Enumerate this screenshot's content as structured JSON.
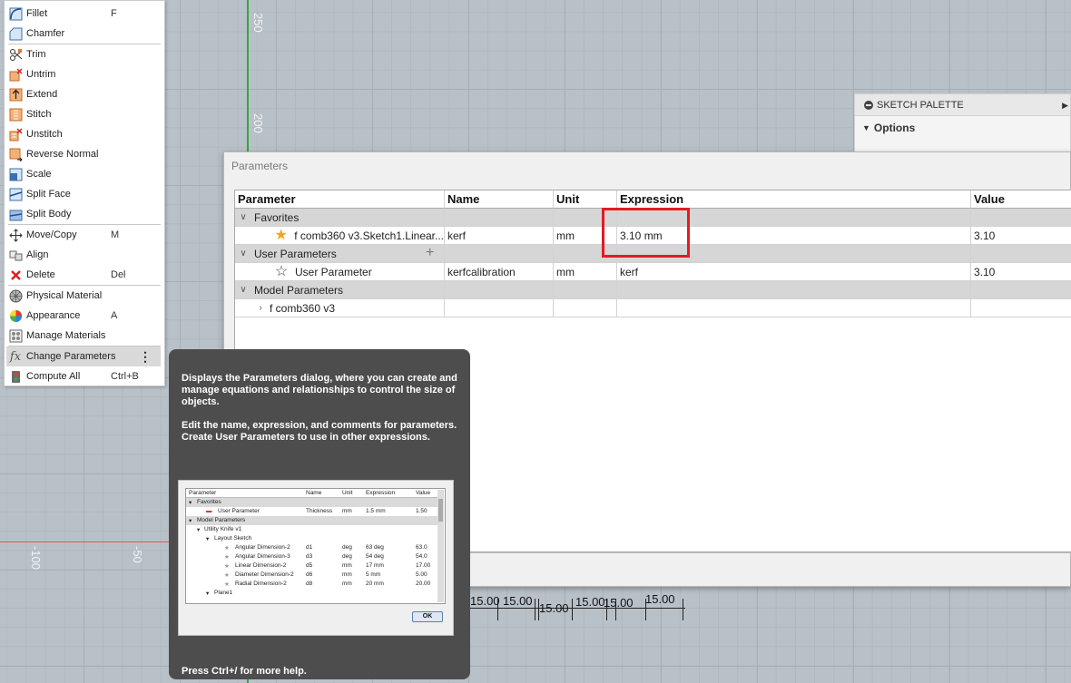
{
  "canvas": {
    "ruler_labels": [
      "250",
      "200",
      "-100",
      "-50"
    ],
    "dimensions": [
      "15.00",
      "15.00",
      "15.00",
      "15.00",
      "15.00",
      "15.00"
    ]
  },
  "menu": {
    "items": [
      {
        "label": "Fillet",
        "shortcut": "F",
        "icon": "fillet-icon"
      },
      {
        "label": "Chamfer",
        "shortcut": "",
        "icon": "chamfer-icon"
      },
      {
        "label": "Trim",
        "shortcut": "",
        "icon": "trim-icon"
      },
      {
        "label": "Untrim",
        "shortcut": "",
        "icon": "untrim-icon"
      },
      {
        "label": "Extend",
        "shortcut": "",
        "icon": "extend-icon"
      },
      {
        "label": "Stitch",
        "shortcut": "",
        "icon": "stitch-icon"
      },
      {
        "label": "Unstitch",
        "shortcut": "",
        "icon": "unstitch-icon"
      },
      {
        "label": "Reverse Normal",
        "shortcut": "",
        "icon": "reverse-normal-icon"
      },
      {
        "label": "Scale",
        "shortcut": "",
        "icon": "scale-icon"
      },
      {
        "label": "Split Face",
        "shortcut": "",
        "icon": "split-face-icon"
      },
      {
        "label": "Split Body",
        "shortcut": "",
        "icon": "split-body-icon"
      },
      {
        "label": "Move/Copy",
        "shortcut": "M",
        "icon": "move-icon"
      },
      {
        "label": "Align",
        "shortcut": "",
        "icon": "align-icon"
      },
      {
        "label": "Delete",
        "shortcut": "Del",
        "icon": "delete-icon"
      },
      {
        "label": "Physical Material",
        "shortcut": "",
        "icon": "physical-material-icon"
      },
      {
        "label": "Appearance",
        "shortcut": "A",
        "icon": "appearance-icon"
      },
      {
        "label": "Manage Materials",
        "shortcut": "",
        "icon": "manage-materials-icon"
      },
      {
        "label": "Change Parameters",
        "shortcut": "",
        "icon": "fx-icon"
      },
      {
        "label": "Compute All",
        "shortcut": "Ctrl+B",
        "icon": "compute-all-icon"
      }
    ]
  },
  "palette": {
    "title": "SKETCH PALETTE",
    "options_label": "Options"
  },
  "dialog": {
    "title": "Parameters",
    "columns": [
      "Parameter",
      "Name",
      "Unit",
      "Expression",
      "Value"
    ],
    "groups": {
      "favorites": "Favorites",
      "user": "User Parameters",
      "model": "Model Parameters"
    },
    "rows": {
      "favorite": {
        "parameter": "f comb360 v3.Sketch1.Linear...",
        "name": "kerf",
        "unit": "mm",
        "expression": "3.10 mm",
        "value": "3.10"
      },
      "user": {
        "parameter": "User Parameter",
        "name": "kerfcalibration",
        "unit": "mm",
        "expression": "kerf",
        "value": "3.10"
      },
      "model": {
        "parameter": "f comb360 v3"
      }
    }
  },
  "tooltip": {
    "para1": "Displays the Parameters dialog, where you can create and manage equations and relationships to control the size of objects.",
    "para2": "Edit the name, expression, and comments for parameters. Create User Parameters to use in other expressions.",
    "footer": "Press Ctrl+/ for more help.",
    "preview": {
      "headers": [
        "Parameter",
        "Name",
        "Unit",
        "Expression",
        "Value"
      ],
      "rows": [
        [
          "Favorites",
          "",
          "",
          "",
          ""
        ],
        [
          "User Parameter",
          "Thickness",
          "mm",
          "1.5 mm",
          "1.50"
        ],
        [
          "Model Parameters",
          "",
          "",
          "",
          ""
        ],
        [
          "Utility Knife v1",
          "",
          "",
          "",
          ""
        ],
        [
          "Layout Sketch",
          "",
          "",
          "",
          ""
        ],
        [
          "Angular Dimension-2",
          "d1",
          "deg",
          "63 deg",
          "63.0"
        ],
        [
          "Angular Dimension-3",
          "d3",
          "deg",
          "54 deg",
          "54.0"
        ],
        [
          "Linear Dimension-2",
          "d5",
          "mm",
          "17 mm",
          "17.00"
        ],
        [
          "Diameter Dimension-2",
          "d6",
          "mm",
          "5 mm",
          "5.00"
        ],
        [
          "Radial Dimension-2",
          "d8",
          "mm",
          "20 mm",
          "20.00"
        ],
        [
          "Plane1",
          "",
          "",
          "",
          ""
        ]
      ],
      "ok_label": "OK"
    }
  },
  "colors": {
    "highlight": "#e31b23",
    "favorite_star": "#f2a516",
    "tooltip_bg": "#4d4d4d"
  }
}
